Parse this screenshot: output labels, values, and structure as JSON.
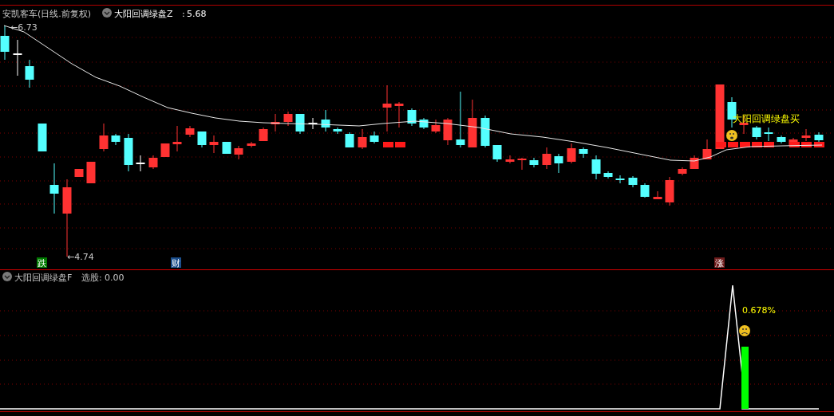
{
  "main_chart": {
    "stock_title": "安凯客车(日线.前复权)",
    "indicator_name": "大阳回调绿盘Z",
    "separator": ":",
    "indicator_value": "5.68",
    "high_label": "←6.73",
    "low_label": "←4.74",
    "signal_label": "大阳回调绿盘买",
    "tags": [
      {
        "text": "跌",
        "color": "#007a00"
      },
      {
        "text": "财",
        "color": "#1c4f8c"
      },
      {
        "text": "涨",
        "color": "#6e1c1c"
      }
    ]
  },
  "sub_chart": {
    "title": "大阳回调绿盘F",
    "label": "选股:",
    "value": "0.00",
    "reading": "0.678%"
  }
}
